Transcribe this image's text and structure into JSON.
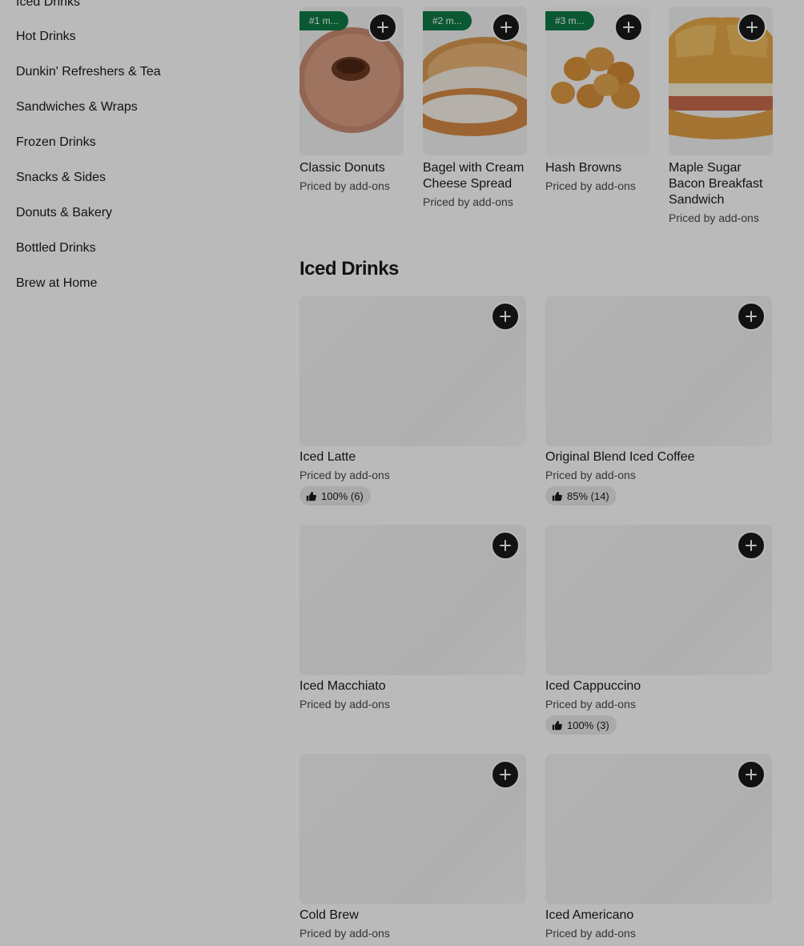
{
  "sidebar": {
    "items": [
      {
        "label": "Iced Drinks"
      },
      {
        "label": "Hot Drinks"
      },
      {
        "label": "Dunkin' Refreshers & Tea"
      },
      {
        "label": "Sandwiches & Wraps"
      },
      {
        "label": "Frozen Drinks"
      },
      {
        "label": "Snacks & Sides"
      },
      {
        "label": "Donuts & Bakery"
      },
      {
        "label": "Bottled Drinks"
      },
      {
        "label": "Brew at Home"
      }
    ]
  },
  "featured": {
    "items": [
      {
        "badge": "#1 m...",
        "name": "Classic Donuts",
        "price": "Priced by add-ons",
        "image_icon": "donut-image"
      },
      {
        "badge": "#2 m...",
        "name": "Bagel with Cream Cheese Spread",
        "price": "Priced by add-ons",
        "image_icon": "bagel-image"
      },
      {
        "badge": "#3 m...",
        "name": "Hash Browns",
        "price": "Priced by add-ons",
        "image_icon": "hash-browns-image"
      },
      {
        "badge": "",
        "name": "Maple Sugar Bacon Breakfast Sandwich",
        "price": "Priced by add-ons",
        "image_icon": "croissant-sandwich-image"
      }
    ]
  },
  "iced_section": {
    "title": "Iced Drinks",
    "items": [
      {
        "name": "Iced Latte",
        "price": "Priced by add-ons",
        "rating": "100% (6)"
      },
      {
        "name": "Original Blend Iced Coffee",
        "price": "Priced by add-ons",
        "rating": "85% (14)"
      },
      {
        "name": "Iced Macchiato",
        "price": "Priced by add-ons",
        "rating": ""
      },
      {
        "name": "Iced Cappuccino",
        "price": "Priced by add-ons",
        "rating": "100% (3)"
      },
      {
        "name": "Cold Brew",
        "price": "Priced by add-ons",
        "rating": ""
      },
      {
        "name": "Iced Americano",
        "price": "Priced by add-ons",
        "rating": ""
      }
    ]
  },
  "colors": {
    "badge": "#0f7b46",
    "button": "#191919",
    "overlay": "rgba(0,0,0,0.27)"
  }
}
